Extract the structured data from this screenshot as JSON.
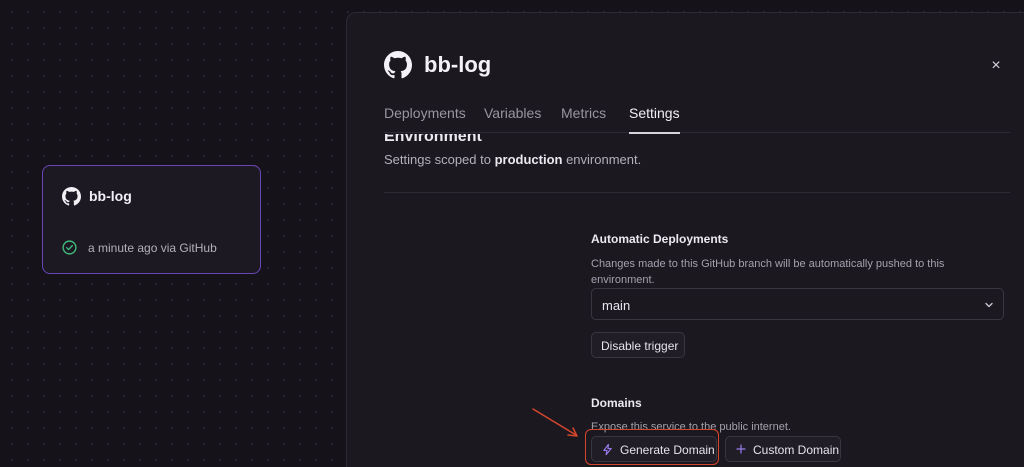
{
  "canvas": {
    "service_card": {
      "name": "bb-log",
      "status": "a minute ago via GitHub",
      "icon": "github-icon",
      "status_icon": "check-circle-icon",
      "border_color": "#6b45b8"
    }
  },
  "panel": {
    "title": "bb-log",
    "title_icon": "github-icon",
    "close_label": "×",
    "tabs": [
      {
        "label": "Deployments"
      },
      {
        "label": "Variables"
      },
      {
        "label": "Metrics"
      },
      {
        "label": "Settings",
        "active": true
      }
    ],
    "environment": {
      "heading": "Environment",
      "sub_prefix": "Settings scoped to ",
      "sub_env": "production",
      "sub_suffix": " environment."
    },
    "auto_deploy": {
      "label": "Automatic Deployments",
      "description": "Changes made to this GitHub branch will be automatically pushed to this environment.",
      "branch": "main",
      "disable_button": "Disable trigger"
    },
    "domains": {
      "label": "Domains",
      "description": "Expose this service to the public internet.",
      "generate_button": "Generate Domain",
      "generate_icon": "lightning-icon",
      "custom_button": "Custom Domain",
      "custom_icon": "plus-icon"
    }
  },
  "colors": {
    "accent": "#8b5cf6",
    "highlight": "#d5472d",
    "status_ok": "#3fb97a"
  }
}
